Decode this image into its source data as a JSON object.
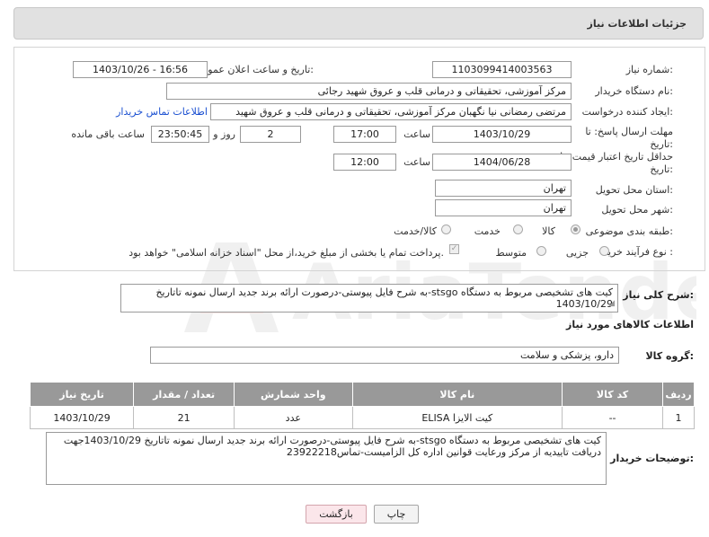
{
  "header": {
    "title": "جزئیات اطلاعات نیاز"
  },
  "fields": {
    "need_number_label": "شماره نیاز:",
    "need_number": "1103099414003563",
    "announce_label": "تاریخ و ساعت اعلان عمومی:",
    "announce_value": "1403/10/26 - 16:56",
    "buyer_label": "نام دستگاه خریدار:",
    "buyer_value": "مرکز آموزشی، تحقیقاتی و درمانی قلب و عروق شهید رجائی",
    "creator_label": "ایجاد کننده درخواست:",
    "creator_value": "مرتضی رمضانی نیا نگهبان مرکز آموزشی، تحقیقاتی و درمانی قلب و عروق شهید",
    "contact_link": "اطلاعات تماس خریدار",
    "deadline_label_1": "مهلت ارسال پاسخ: تا",
    "deadline_label_2": "تاریخ:",
    "deadline_date": "1403/10/29",
    "time_label": "ساعت",
    "deadline_time": "17:00",
    "days_value": "2",
    "days_label": "روز و",
    "remaining_time": "23:50:45",
    "remaining_label": "ساعت باقی مانده",
    "validity_label_1": "حداقل تاریخ اعتبار قیمت: تا",
    "validity_label_2": "تاریخ:",
    "validity_date": "1404/06/28",
    "validity_time_label": "ساعت",
    "validity_time": "12:00",
    "province_label": "استان محل تحویل:",
    "province_value": "تهران",
    "city_label": "شهر محل تحویل:",
    "city_value": "تهران",
    "category_label": "طبقه بندی موضوعی:",
    "category_options": [
      "کالا",
      "خدمت",
      "کالا/خدمت"
    ],
    "process_label": "نوع فرآیند خرید :",
    "process_options": [
      "جزیی",
      "متوسط"
    ],
    "payment_note": "پرداخت تمام یا بخشی از مبلغ خرید،از محل \"اسناد خزانه اسلامی\" خواهد بود."
  },
  "description": {
    "label": "شرح کلی نیاز:",
    "text": "کیت های  تشخیصی مربوط به دستگاه stsgo-به شرح فایل پیوستی-درصورت ارائه برند جدید ارسال نمونه تاتاریخ 1403/10/29"
  },
  "goods": {
    "section_title": "اطلاعات کالاهای مورد نیاز",
    "group_label": "گروه کالا:",
    "group_value": "دارو، پزشکی و سلامت",
    "columns": [
      "ردیف",
      "کد کالا",
      "نام کالا",
      "واحد شمارش",
      "تعداد / مقدار",
      "تاریخ نیاز"
    ],
    "rows": [
      {
        "row": "1",
        "code": "--",
        "name": "کیت الایزا ELISA",
        "unit": "عدد",
        "qty": "21",
        "date": "1403/10/29"
      }
    ]
  },
  "buyer_notes": {
    "label": "توضیحات خریدار:",
    "text": "کیت های  تشخیصی مربوط به دستگاه stsgo-به شرح فایل پیوستی-درصورت ارائه برند جدید ارسال نمونه تاتاریخ 1403/10/29جهت دریافت تاییدیه از مرکز ورعایت قوانین اداره کل الزامیست-تماس23922218"
  },
  "buttons": {
    "print": "چاپ",
    "back": "بازگشت"
  },
  "watermark_text": "AriaTender.neT"
}
